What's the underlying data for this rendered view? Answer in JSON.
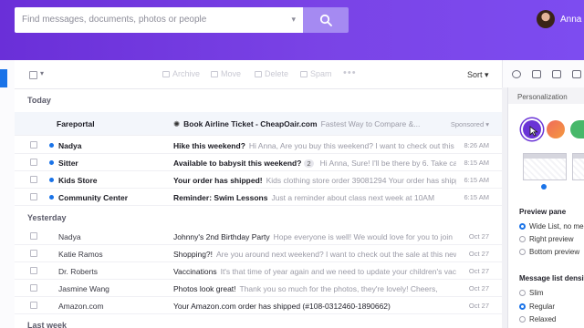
{
  "search": {
    "placeholder": "Find messages, documents, photos or people"
  },
  "user": {
    "name": "Anna"
  },
  "toolbar": {
    "actions": [
      "Archive",
      "Move",
      "Delete",
      "Spam"
    ],
    "more": "•••",
    "sort_label": "Sort"
  },
  "sections": {
    "today": "Today",
    "yesterday": "Yesterday",
    "last_week": "Last week"
  },
  "sponsored": {
    "sender": "Fareportal",
    "subject": "Book Airline Ticket - CheapOair.com",
    "preview": "Fastest Way to Compare &...",
    "label": "Sponsored"
  },
  "messages_today": [
    {
      "sender": "Nadya",
      "subject": "Hike this weekend?",
      "preview": "Hi Anna, Are you buy this weekend? I want to check out this",
      "time": "8:26 AM",
      "unread": true
    },
    {
      "sender": "Sitter",
      "subject": "Available to babysit this weekend?",
      "count": "2",
      "preview": "Hi Anna, Sure! I'll be there by 6. Take care, Sara",
      "time": "8:15 AM",
      "unread": true
    },
    {
      "sender": "Kids Store",
      "subject": "Your order has shipped!",
      "preview": "Kids clothing store order 39081294 Your order has shipped and",
      "time": "6:15 AM",
      "unread": true
    },
    {
      "sender": "Community Center",
      "subject": "Reminder: Swim Lessons",
      "preview": "Just a reminder about class next week at 10AM",
      "time": "6:15 AM",
      "unread": true
    }
  ],
  "messages_yesterday": [
    {
      "sender": "Nadya",
      "subject": "Johnny's 2nd Birthday Party",
      "preview": "Hope everyone is well! We would love for you to join",
      "time": "Oct 27"
    },
    {
      "sender": "Katie Ramos",
      "subject": "Shopping?!",
      "preview": "Are you around next weekend? I want to check out the sale at this new boutique",
      "time": "Oct 27"
    },
    {
      "sender": "Dr. Roberts",
      "subject": "Vaccinations",
      "preview": "It's that time of year again and we need to update your children's vaccinations",
      "time": "Oct 27"
    },
    {
      "sender": "Jasmine Wang",
      "subject": "Photos look great!",
      "preview": "Thank you so much for the photos, they're lovely! Cheers,",
      "time": "Oct 27"
    },
    {
      "sender": "Amazon.com",
      "subject": "Your Amazon.com order has shipped (#108-0312460-1890662)",
      "preview": "",
      "time": "Oct 27"
    }
  ],
  "panel": {
    "title": "Personalization",
    "preview_pane": {
      "heading": "Preview pane",
      "options": [
        "Wide List, no me",
        "Right preview",
        "Bottom preview"
      ],
      "selected": 0
    },
    "density": {
      "heading": "Message list densit",
      "options": [
        "Slim",
        "Regular",
        "Relaxed"
      ],
      "selected": 1
    },
    "colors": {
      "purple": "#6a34d6",
      "orange": "#f06a5b",
      "green": "#47b86a"
    }
  },
  "accent_color": "#1a73e8"
}
